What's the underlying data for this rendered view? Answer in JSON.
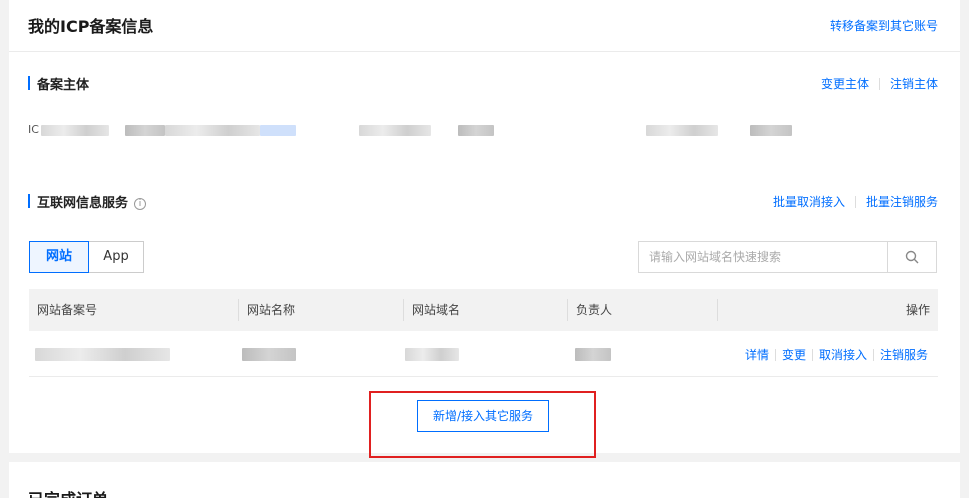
{
  "header": {
    "title": "我的ICP备案信息",
    "transfer_link": "转移备案到其它账号"
  },
  "subject_section": {
    "title": "备案主体",
    "links": [
      "变更主体",
      "注销主体"
    ],
    "row_prefix": "IC"
  },
  "service_section": {
    "title": "互联网信息服务",
    "info_icon": "info-circle-icon",
    "links": [
      "批量取消接入",
      "批量注销服务"
    ]
  },
  "tabs": [
    {
      "label": "网站",
      "active": true
    },
    {
      "label": "App",
      "active": false
    }
  ],
  "search": {
    "placeholder": "请输入网站域名快速搜索",
    "icon": "search-icon"
  },
  "table": {
    "columns": [
      "网站备案号",
      "网站名称",
      "网站域名",
      "负责人",
      "操作"
    ],
    "row_actions": [
      "详情",
      "变更",
      "取消接入",
      "注销服务"
    ]
  },
  "add_button": "新增/接入其它服务",
  "bottom_section": {
    "title": "已完成订单"
  },
  "colors": {
    "accent": "#006eff",
    "highlight": "#e02020"
  }
}
